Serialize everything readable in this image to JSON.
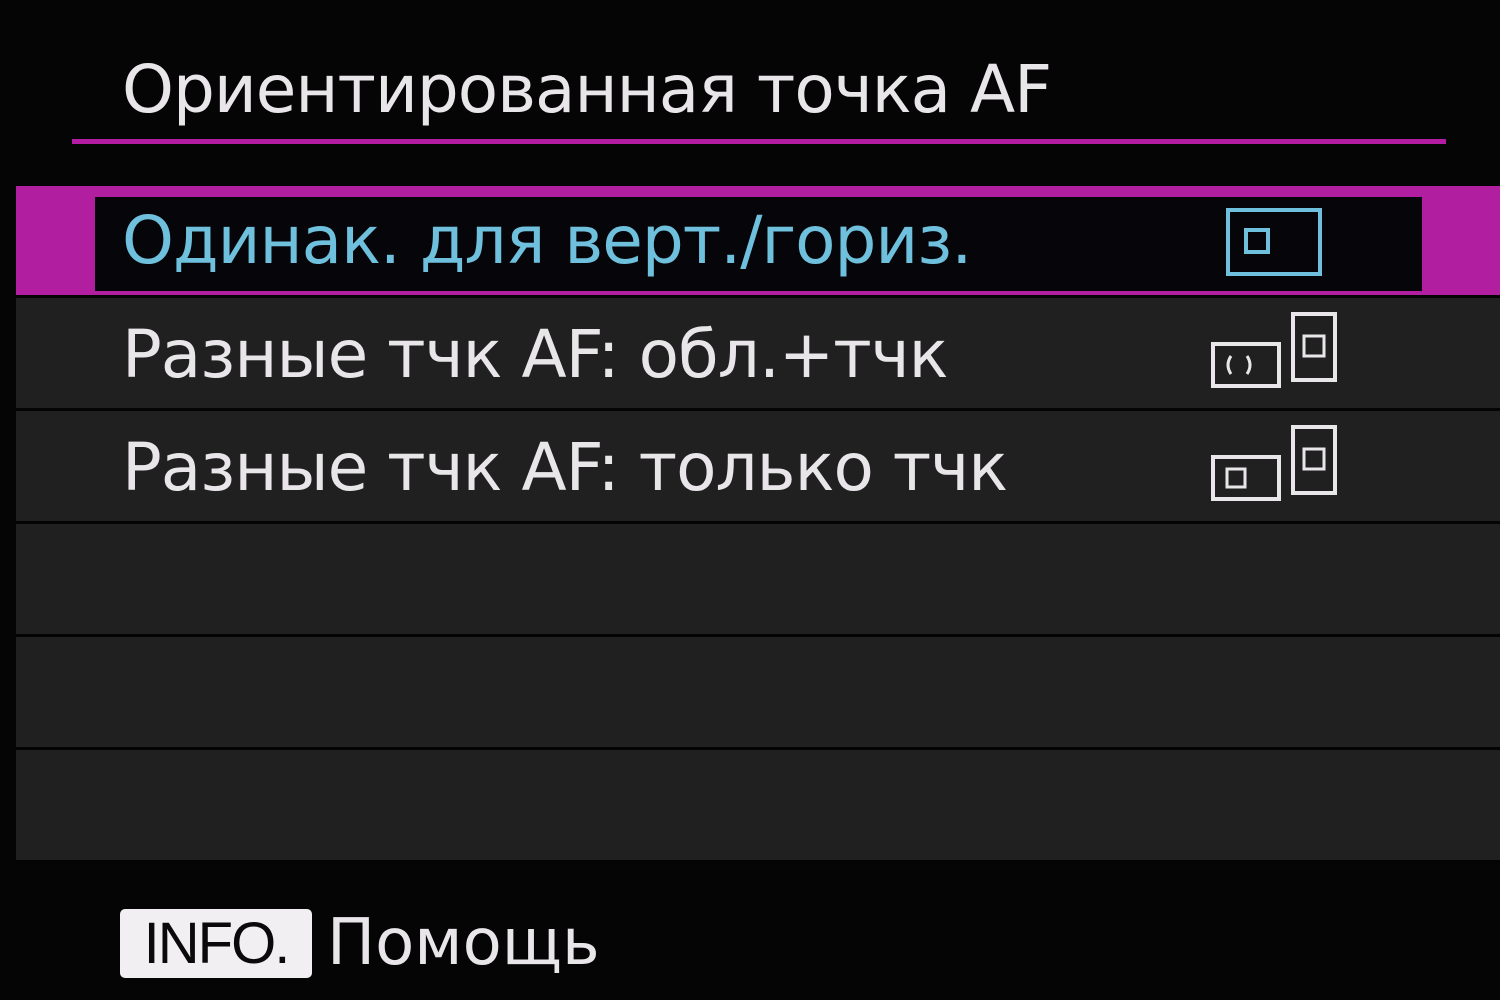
{
  "screen": {
    "title": "Ориентированная точка AF",
    "accent_color": "#b11ea0",
    "selected_text_color": "#6fc0dc"
  },
  "menu": {
    "items": [
      {
        "label": "Одинак. для верт./гориз.",
        "icon": "same-af-point-icon",
        "selected": true
      },
      {
        "label": "Разные тчк AF: обл.+тчк",
        "icon": "separate-area-and-point-icon",
        "selected": false
      },
      {
        "label": "Разные тчк AF: только тчк",
        "icon": "separate-point-only-icon",
        "selected": false
      }
    ]
  },
  "footer": {
    "info_button": "INFO.",
    "info_label": "Помощь"
  }
}
